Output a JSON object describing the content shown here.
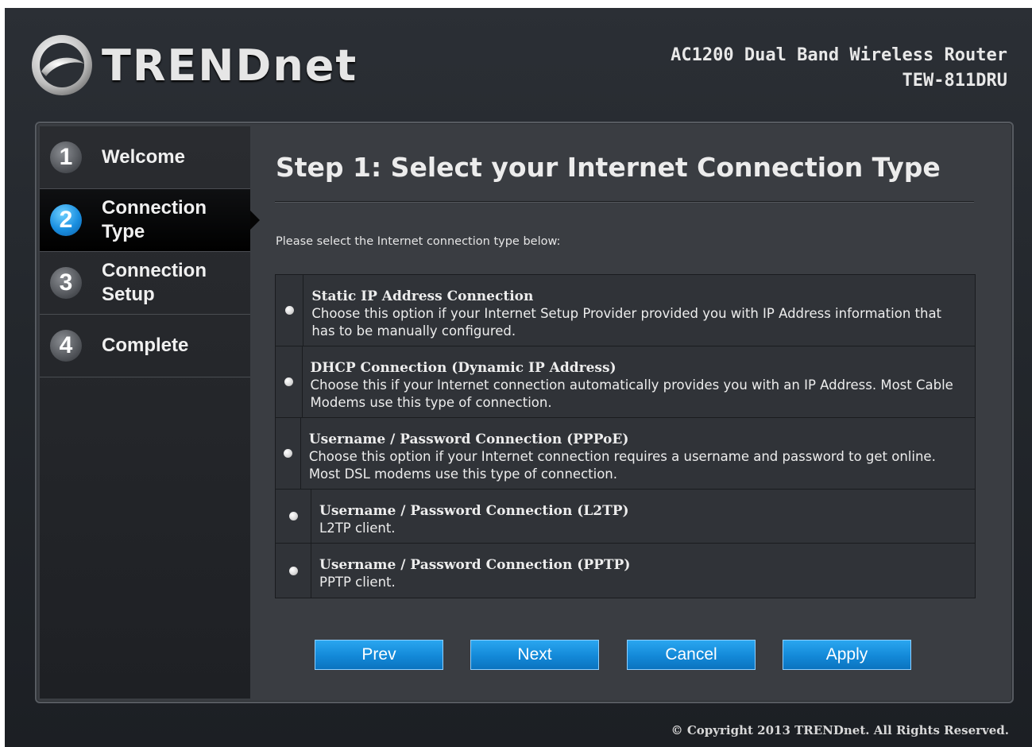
{
  "header": {
    "brand": "TRENDnet",
    "logo_icon": "trendnet-swoosh-logo",
    "product_name": "AC1200 Dual Band Wireless Router",
    "model": "TEW-811DRU"
  },
  "steps": [
    {
      "number": "1",
      "label": "Welcome",
      "active": false
    },
    {
      "number": "2",
      "label": "Connection Type",
      "active": true
    },
    {
      "number": "3",
      "label": "Connection Setup",
      "active": false
    },
    {
      "number": "4",
      "label": "Complete",
      "active": false
    }
  ],
  "content": {
    "title": "Step 1: Select your Internet Connection Type",
    "subtitle": "Please select the Internet connection type below:"
  },
  "options": [
    {
      "title": "Static IP Address Connection",
      "description": "Choose this option if your Internet Setup Provider provided you with IP Address information that has to be manually configured."
    },
    {
      "title": "DHCP Connection (Dynamic IP Address)",
      "description": "Choose this if your Internet connection automatically provides you with an IP Address. Most Cable Modems use this type of connection."
    },
    {
      "title": "Username / Password Connection (PPPoE)",
      "description": "Choose this option if your Internet connection requires a username and password to get online. Most DSL modems use this type of connection."
    },
    {
      "title": "Username / Password Connection (L2TP)",
      "description": "L2TP client."
    },
    {
      "title": "Username / Password Connection (PPTP)",
      "description": "PPTP client."
    }
  ],
  "buttons": {
    "prev": "Prev",
    "next": "Next",
    "cancel": "Cancel",
    "apply": "Apply"
  },
  "footer": {
    "copyright": "© Copyright 2013 TRENDnet. All Rights Reserved."
  },
  "colors": {
    "accent_blue": "#1389d8",
    "background_dark": "#23272c"
  }
}
